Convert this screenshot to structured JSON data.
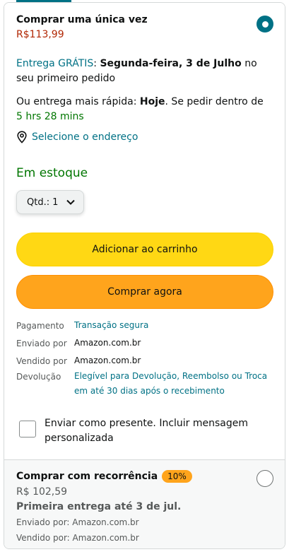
{
  "once": {
    "title": "Comprar uma única vez",
    "price": "R$113,99",
    "delivery_free": "Entrega GRÁTIS",
    "delivery_colon": ": ",
    "delivery_date": "Segunda-feira, 3 de Julho",
    "delivery_rest": " no seu primeiro pedido",
    "faster_prefix": "Ou entrega mais rápida: ",
    "faster_day": "Hoje",
    "faster_mid": ". Se pedir dentro de ",
    "faster_time": "5 hrs 28 mins",
    "address_link": "Selecione o endereço",
    "stock": "Em estoque",
    "qty_label": "Qtd.:",
    "qty_value": "1",
    "add_to_cart": "Adicionar ao carrinho",
    "buy_now": "Comprar agora",
    "info": [
      {
        "label": "Pagamento",
        "value": "Transação segura",
        "link": true
      },
      {
        "label": "Enviado por",
        "value": "Amazon.com.br",
        "link": false
      },
      {
        "label": "Vendido por",
        "value": "Amazon.com.br",
        "link": false
      },
      {
        "label": "Devolução",
        "value": "Elegível para Devolução, Reembolso ou Troca em até 30 dias após o recebimento",
        "link": true
      }
    ],
    "gift_text": "Enviar como presente. Incluir mensagem personalizada"
  },
  "recurring": {
    "title": "Comprar com recorrência",
    "badge": "10%",
    "price": "R$ 102,59",
    "first_delivery": "Primeira entrega até 3 de jul.",
    "shipped_by": "Enviado por: Amazon.com.br",
    "sold_by": "Vendido por: Amazon.com.br"
  },
  "colors": {
    "accent": "#007185",
    "price": "#b12704",
    "in_stock": "#007600",
    "cart_button": "#ffd814",
    "buy_button": "#ffa41c"
  }
}
